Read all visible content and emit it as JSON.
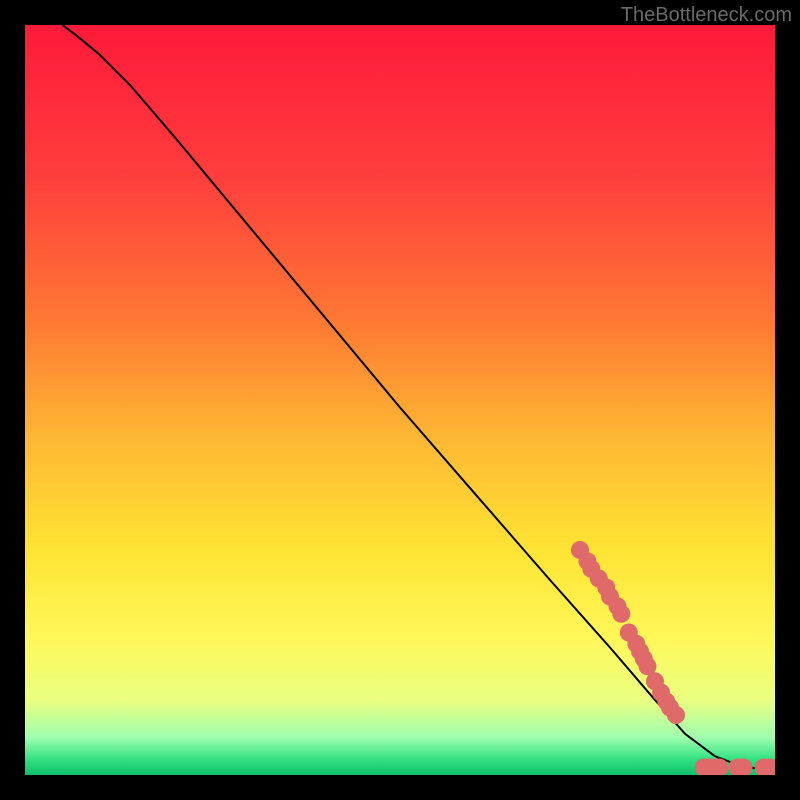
{
  "attribution": "TheBottleneck.com",
  "chart_data": {
    "type": "line",
    "title": "",
    "xlabel": "",
    "ylabel": "",
    "xlim": [
      0,
      100
    ],
    "ylim": [
      0,
      100
    ],
    "gradient_stops": [
      {
        "offset": 0,
        "color": "#ff1a3a"
      },
      {
        "offset": 20,
        "color": "#ff3d3d"
      },
      {
        "offset": 40,
        "color": "#ff7a33"
      },
      {
        "offset": 55,
        "color": "#ffb733"
      },
      {
        "offset": 70,
        "color": "#ffe433"
      },
      {
        "offset": 82,
        "color": "#fff85a"
      },
      {
        "offset": 90,
        "color": "#eaff80"
      },
      {
        "offset": 95,
        "color": "#9fffb0"
      },
      {
        "offset": 98,
        "color": "#30e080"
      },
      {
        "offset": 100,
        "color": "#0dbf6c"
      }
    ],
    "curve": [
      {
        "x": 5.0,
        "y": 100.0
      },
      {
        "x": 7.0,
        "y": 98.5
      },
      {
        "x": 10.0,
        "y": 96.0
      },
      {
        "x": 14.0,
        "y": 92.0
      },
      {
        "x": 20.0,
        "y": 85.0
      },
      {
        "x": 30.0,
        "y": 73.0
      },
      {
        "x": 40.0,
        "y": 61.0
      },
      {
        "x": 50.0,
        "y": 49.0
      },
      {
        "x": 60.0,
        "y": 37.5
      },
      {
        "x": 70.0,
        "y": 26.0
      },
      {
        "x": 78.0,
        "y": 17.0
      },
      {
        "x": 84.0,
        "y": 10.0
      },
      {
        "x": 88.0,
        "y": 5.5
      },
      {
        "x": 92.0,
        "y": 2.5
      },
      {
        "x": 96.0,
        "y": 1.0
      },
      {
        "x": 100.0,
        "y": 0.8
      }
    ],
    "scatter_color": "#e06a6a",
    "scatter_radius": 9,
    "scatter_points": [
      {
        "x": 74.0,
        "y": 30.0
      },
      {
        "x": 75.0,
        "y": 28.5
      },
      {
        "x": 75.5,
        "y": 27.5
      },
      {
        "x": 76.5,
        "y": 26.2
      },
      {
        "x": 77.5,
        "y": 25.0
      },
      {
        "x": 78.0,
        "y": 23.8
      },
      {
        "x": 79.0,
        "y": 22.5
      },
      {
        "x": 79.5,
        "y": 21.5
      },
      {
        "x": 80.5,
        "y": 19.0
      },
      {
        "x": 81.5,
        "y": 17.5
      },
      {
        "x": 82.0,
        "y": 16.5
      },
      {
        "x": 82.5,
        "y": 15.5
      },
      {
        "x": 83.0,
        "y": 14.5
      },
      {
        "x": 84.0,
        "y": 12.5
      },
      {
        "x": 84.8,
        "y": 11.0
      },
      {
        "x": 85.5,
        "y": 9.8
      },
      {
        "x": 86.0,
        "y": 9.0
      },
      {
        "x": 86.8,
        "y": 8.0
      },
      {
        "x": 90.5,
        "y": 1.0
      },
      {
        "x": 91.2,
        "y": 1.0
      },
      {
        "x": 92.0,
        "y": 1.0
      },
      {
        "x": 92.6,
        "y": 1.0
      },
      {
        "x": 95.0,
        "y": 1.0
      },
      {
        "x": 95.8,
        "y": 1.0
      },
      {
        "x": 98.5,
        "y": 1.0
      },
      {
        "x": 99.3,
        "y": 1.0
      }
    ]
  }
}
